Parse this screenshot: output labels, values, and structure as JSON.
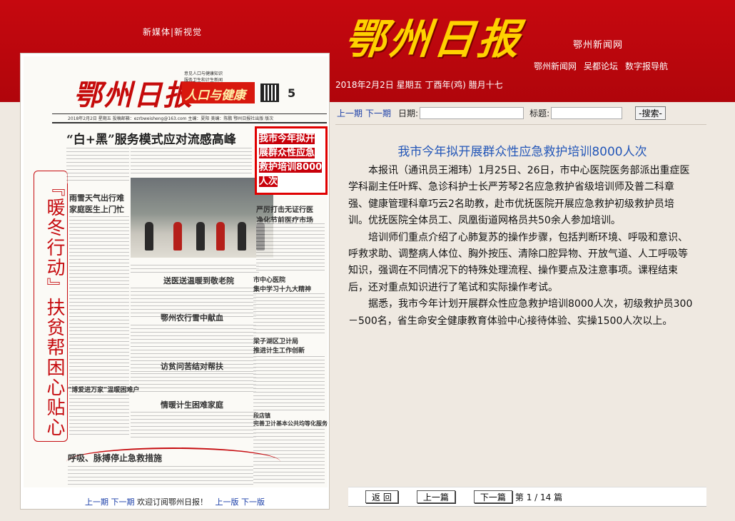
{
  "header": {
    "left_label": "新媒体|新视觉",
    "masthead": "鄂州日报",
    "site_name": "鄂州新闻网",
    "links": [
      "鄂州新闻网",
      "吴都论坛",
      "数字报导航"
    ],
    "date_line": "2018年2月2日 星期五 丁酉年(鸡) 腊月十七"
  },
  "paper": {
    "logo": "鄂州日报",
    "top_small": "意见人口与健康知识\n服务卫生和计生新闻",
    "banner": "人口与健康",
    "page_number": "5",
    "sub_row": "2018年2月2日  星期五    投稿邮箱：ezrbweisheng@163.com    主编：夏阳    美编：陈鹏    鄂州日报社出版    版次",
    "headline": "“白+黑”服务模式应对流感高峰",
    "vertical_title": "『暖冬行动』扶贫帮困心贴心",
    "subheads": [
      "雨雪天气出行难\n家庭医生上门忙",
      "送医送温暖到敬老院",
      "鄂州农行雪中献血",
      "访贫问苦结对帮扶",
      "情暖计生困难家庭",
      "“博爱进万家”温暖困难户",
      "呼吸、脉搏停止急救措施",
      "严厉打击无证行医\n净化节前医疗市场",
      "市中心医院\n集中学习十九大精神",
      "梁子湖区卫计局\n推进计生工作创新",
      "段店镇\n完善卫计基本公共均等化服务"
    ],
    "highlight": "我市今年拟开展群众性应急救护培训8000人次",
    "nav": {
      "prev_page": "上一期",
      "next_page": "下一期",
      "welcome": "欢迎订阅鄂州日报！",
      "prev_edition": "上一版",
      "next_edition": "下一版"
    }
  },
  "search": {
    "prev": "上一期",
    "next": "下一期",
    "date_label": "日期:",
    "title_label": "标题:",
    "date_value": "",
    "title_value": "",
    "button": "-搜索-"
  },
  "article": {
    "title": "我市今年拟开展群众性应急救护培训8000人次",
    "paragraphs": [
      "本报讯（通讯员王湘玮）1月25日、26日，市中心医院医务部派出重症医学科副主任叶辉、急诊科护士长严芳琴2名应急救护省级培训师及普二科章强、健康管理科章巧云2名助教，赴市优抚医院开展应急救护初级救护员培训。优抚医院全体员工、凤凰街道网格员共50余人参加培训。",
      "培训师们重点介绍了心肺复苏的操作步骤，包括判断环境、呼吸和意识、呼救求助、调整病人体位、胸外按压、清除口腔异物、开放气道、人工呼吸等知识，强调在不同情况下的特殊处理流程、操作要点及注意事项。课程结束后，还对重点知识进行了笔试和实际操作考试。",
      "据悉，我市今年计划开展群众性应急救护培训8000人次，初级救护员300－500名，省生命安全健康教育体验中心接待体验、实操1500人次以上。"
    ]
  },
  "pager": {
    "back": "返 回",
    "prev": "上一篇",
    "next": "下一篇",
    "page_prefix": "第",
    "current": "1",
    "sep": "/",
    "total": "14",
    "page_suffix": "篇"
  }
}
